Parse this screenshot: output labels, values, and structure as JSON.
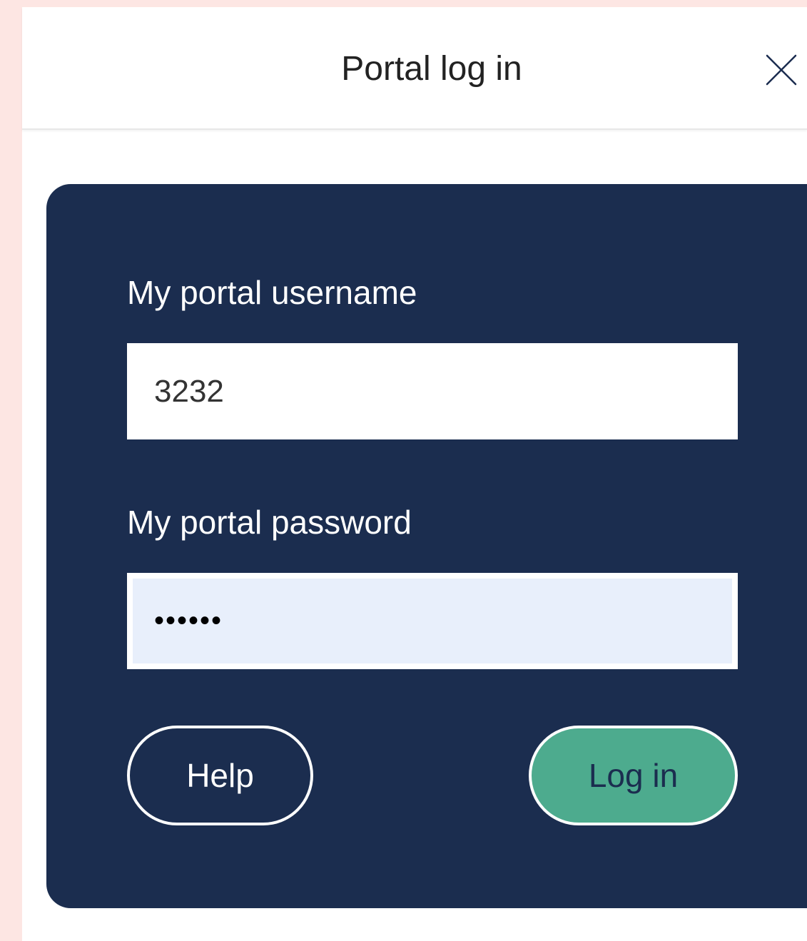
{
  "dialog": {
    "title": "Portal log in",
    "close_icon": "close-icon"
  },
  "form": {
    "username_label": "My portal username",
    "username_value": "3232",
    "password_label": "My portal password",
    "password_value": "••••••"
  },
  "buttons": {
    "help_label": "Help",
    "login_label": "Log in"
  },
  "colors": {
    "page_background": "#fde6e3",
    "card_background": "#1b2d4f",
    "login_button": "#4dab8e",
    "password_field_background": "#e8effb"
  }
}
